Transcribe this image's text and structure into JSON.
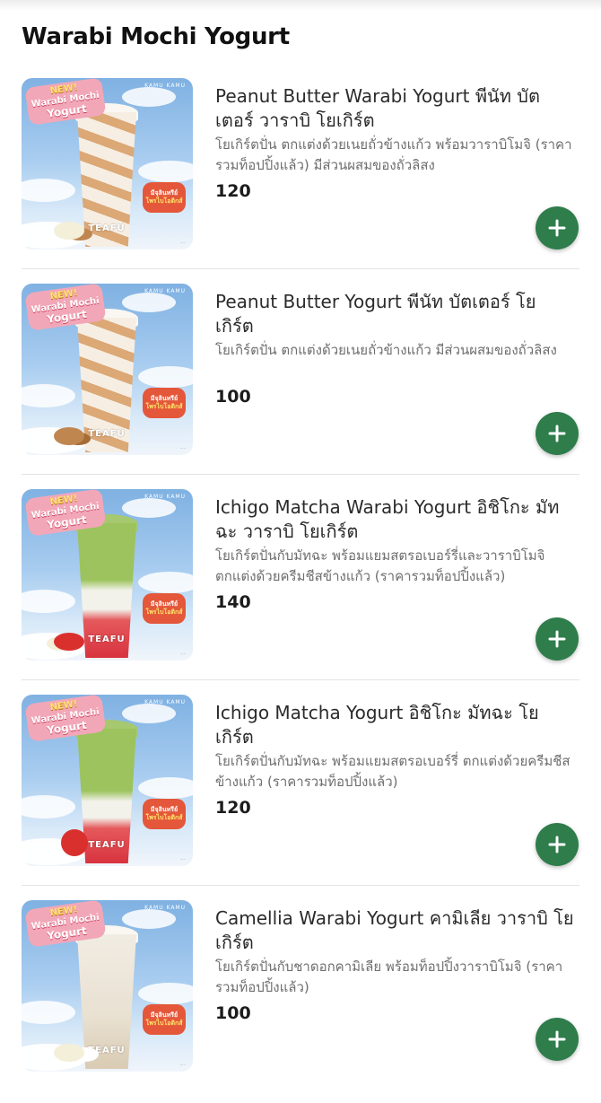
{
  "section": {
    "title": "Warabi Mochi Yogurt"
  },
  "thumbnail_text": {
    "badge_new": "NEW!",
    "badge_line1": "Warabi Mochi",
    "badge_line2": "Yogurt",
    "brand": "TEAFU",
    "brand_top": "KAMU KAMU",
    "sticker_line1": "มีจุลินทรีย์",
    "sticker_line2": "โพรไบโอติกส์"
  },
  "colors": {
    "accent": "#2e7d4b",
    "price": "#1c1c1c",
    "description": "#6e6e6e"
  },
  "items": [
    {
      "name": "Peanut Butter Warabi Yogurt พีนัท บัตเตอร์ วาราบิ โยเกิร์ต",
      "description": "โยเกิร์ตปั่น ตกแต่งด้วยเนยถั่วข้างแก้ว พร้อมวาราบิโมจิ (ราคารวมท็อปปิ้งแล้ว) มีส่วนผสมของถั่วลิสง",
      "price": "120",
      "add_icon": "plus-icon"
    },
    {
      "name": "Peanut Butter Yogurt พีนัท บัตเตอร์ โยเกิร์ต",
      "description": "โยเกิร์ตปั่น ตกแต่งด้วยเนยถั่วข้างแก้ว มีส่วนผสมของถั่วลิสง",
      "price": "100",
      "add_icon": "plus-icon"
    },
    {
      "name": "Ichigo Matcha Warabi Yogurt อิชิโกะ มัทฉะ วาราบิ โยเกิร์ต",
      "description": "โยเกิร์ตปั่นกับมัทฉะ พร้อมแยมสตรอเบอร์รี่และวาราบิโมจิ ตกแต่งด้วยครีมชีสข้างแก้ว (ราคารวมท็อปปิ้งแล้ว)",
      "price": "140",
      "add_icon": "plus-icon"
    },
    {
      "name": "Ichigo Matcha Yogurt อิชิโกะ มัทฉะ โยเกิร์ต",
      "description": "โยเกิร์ตปั่นกับมัทฉะ พร้อมแยมสตรอเบอร์รี่ ตกแต่งด้วยครีมชีสข้างแก้ว (ราคารวมท็อปปิ้งแล้ว)",
      "price": "120",
      "add_icon": "plus-icon"
    },
    {
      "name": "Camellia Warabi Yogurt คามิเลีย วาราบิ โยเกิร์ต",
      "description": "โยเกิร์ตปั่นกับชาดอกคามิเลีย พร้อมท็อปปิ้งวาราบิโมจิ (ราคารวมท็อปปิ้งแล้ว)",
      "price": "100",
      "add_icon": "plus-icon"
    }
  ]
}
